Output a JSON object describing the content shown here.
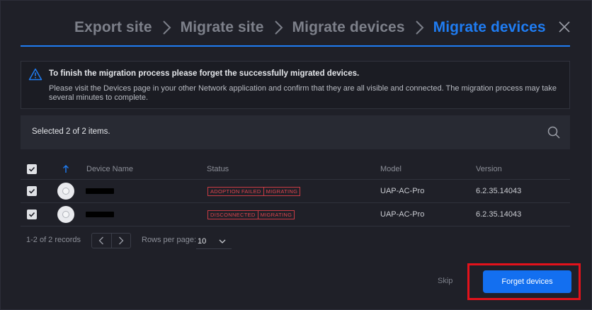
{
  "breadcrumb": {
    "items": [
      "Export site",
      "Migrate site",
      "Migrate devices",
      "Migrate devices"
    ]
  },
  "icons": {
    "close": "close-icon",
    "warning": "warning-icon",
    "search": "search-icon",
    "sort": "arrow-up-icon",
    "chevron": "chevron-right-icon",
    "accent": "#1f7cf2",
    "error": "#e0454e"
  },
  "notice": {
    "title": "To finish the migration process please forget the successfully migrated devices.",
    "body": "Please visit the Devices page in your other Network application and confirm that they are all visible and connected. The migration process may take several minutes to complete."
  },
  "selection": {
    "text": "Selected 2 of 2 items."
  },
  "table": {
    "columns": [
      "Device Name",
      "Status",
      "Model",
      "Version"
    ],
    "rows": [
      {
        "status": [
          "ADOPTION FAILED",
          "MIGRATING"
        ],
        "model": "UAP-AC-Pro",
        "version": "6.2.35.14043"
      },
      {
        "status": [
          "DISCONNECTED",
          "MIGRATING"
        ],
        "model": "UAP-AC-Pro",
        "version": "6.2.35.14043"
      }
    ]
  },
  "pagination": {
    "records": "1-2 of 2 records",
    "rows_per_page_label": "Rows per page:",
    "rows_per_page_value": "10"
  },
  "footer": {
    "skip_label": "Skip",
    "forget_label": "Forget devices"
  }
}
